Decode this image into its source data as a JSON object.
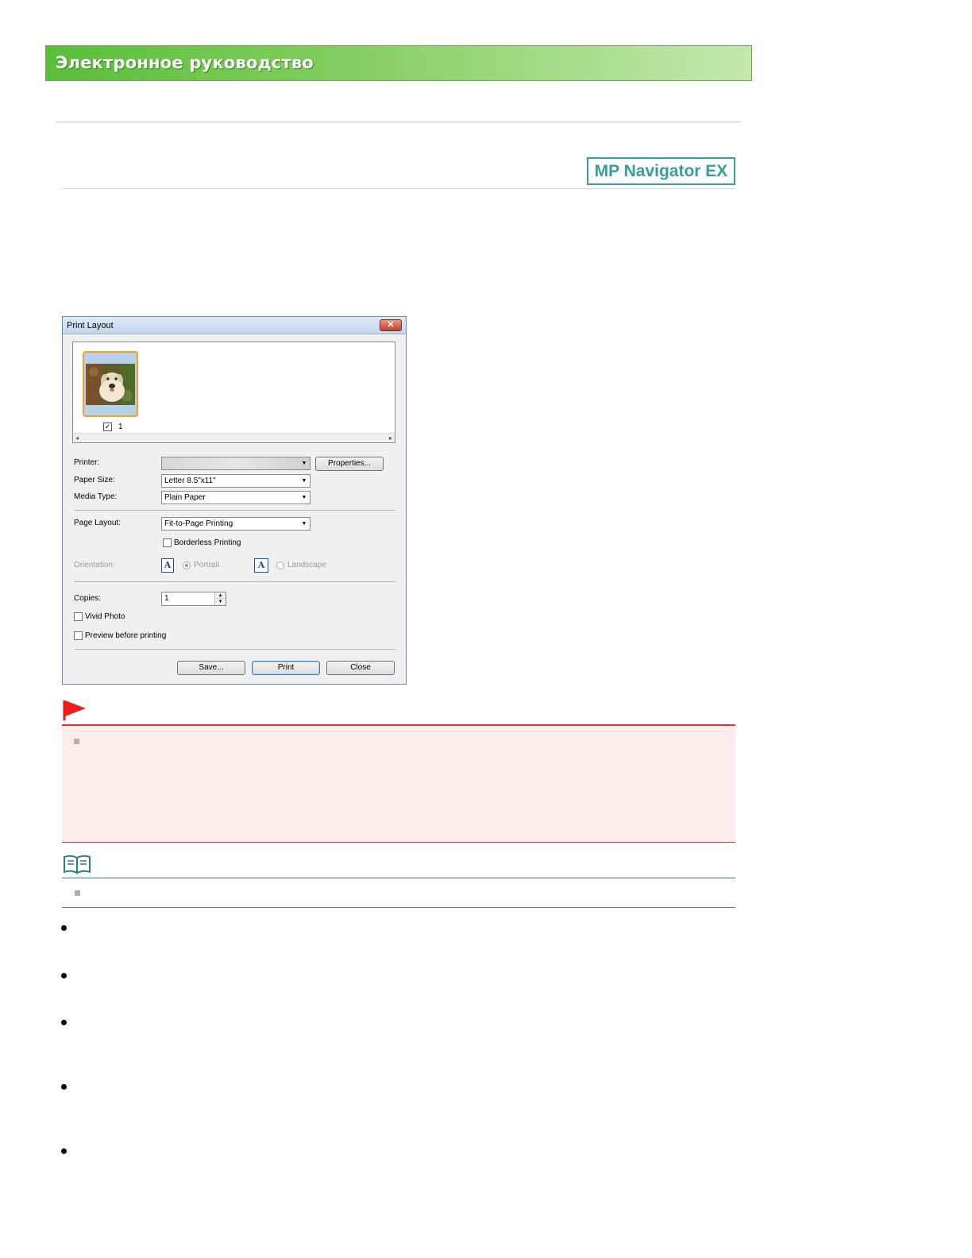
{
  "header": {
    "title": "Электронное руководство"
  },
  "badge": {
    "label": "MP Navigator EX"
  },
  "dialog": {
    "title": "Print Layout",
    "close_glyph": "✕",
    "thumbnail": {
      "checked": true,
      "number": "1"
    },
    "printer": {
      "label": "Printer:",
      "value": "",
      "properties_label": "Properties..."
    },
    "paper_size": {
      "label": "Paper Size:",
      "value": "Letter 8.5\"x11\""
    },
    "media_type": {
      "label": "Media Type:",
      "value": "Plain Paper"
    },
    "page_layout": {
      "label": "Page Layout:",
      "value": "Fit-to-Page Printing"
    },
    "borderless": {
      "label": "Borderless Printing",
      "checked": false
    },
    "orientation": {
      "label": "Orientation:",
      "portrait_label": "Portrait",
      "landscape_label": "Landscape",
      "icon_glyph": "A",
      "selected": "portrait"
    },
    "copies": {
      "label": "Copies:",
      "value": "1"
    },
    "vivid_photo": {
      "label": "Vivid Photo",
      "checked": false
    },
    "preview": {
      "label": "Preview before printing",
      "checked": false
    },
    "buttons": {
      "save": "Save...",
      "print": "Print",
      "close": "Close"
    }
  },
  "colors": {
    "header_green": "#5bbd3a",
    "badge_teal": "#3a9d9b",
    "important_red": "#d23333",
    "important_bg": "#fdecec",
    "note_teal": "#3a7f7d",
    "selection_orange": "#f0a21c"
  },
  "icons": {
    "important": "red-flag-icon",
    "note": "open-book-icon",
    "close": "close-icon",
    "dropdown": "chevron-down-icon"
  }
}
